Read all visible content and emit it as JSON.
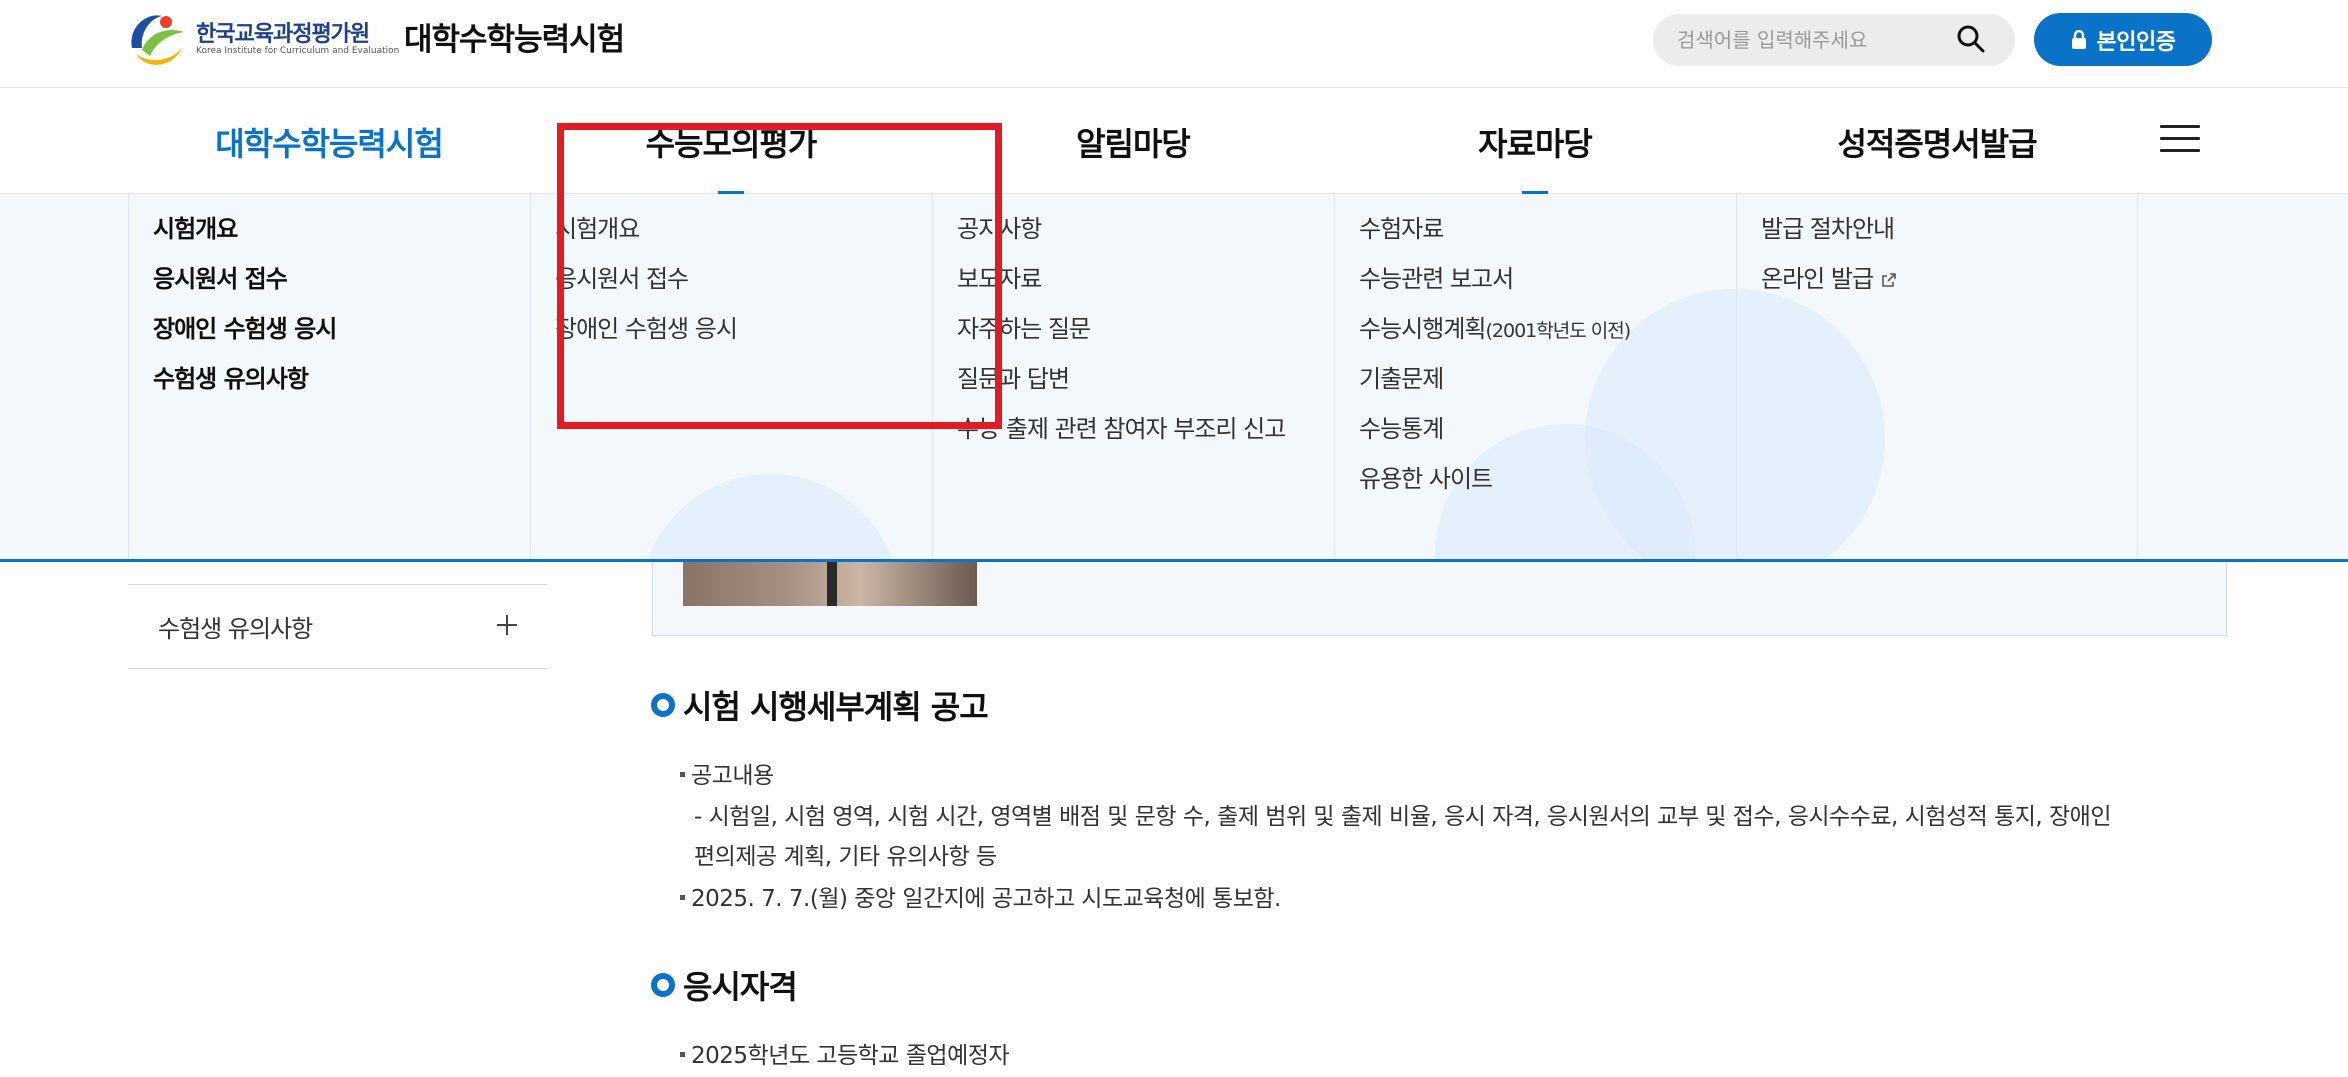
{
  "header": {
    "logo": {
      "name_ko": "한국교육과정평가원",
      "name_en": "Korea Institute for Curriculum and Evaluation"
    },
    "site_title": "대학수학능력시험",
    "search": {
      "placeholder": "검색어를 입력해주세요",
      "value": ""
    },
    "auth_button": "본인인증"
  },
  "gnb": {
    "items": [
      {
        "label": "대학수학능력시험",
        "active": true
      },
      {
        "label": "수능모의평가",
        "active": false
      },
      {
        "label": "알림마당",
        "active": false
      },
      {
        "label": "자료마당",
        "active": false
      },
      {
        "label": "성적증명서발급",
        "active": false
      }
    ]
  },
  "mega_menu": {
    "col1": [
      "시험개요",
      "응시원서 접수",
      "장애인 수험생 응시",
      "수험생 유의사항"
    ],
    "col2": [
      "시험개요",
      "응시원서 접수",
      "장애인 수험생 응시"
    ],
    "col3": [
      "공지사항",
      "보도자료",
      "자주하는 질문",
      "질문과 답변",
      "수능 출제 관련 참여자 부조리 신고"
    ],
    "col4": {
      "item1": "수험자료",
      "item2": "수능관련 보고서",
      "item3_main": "수능시행계획",
      "item3_note": "(2001학년도 이전)",
      "item4": "기출문제",
      "item5": "수능통계",
      "item6": "유용한 사이트"
    },
    "col5": [
      "발급 절차안내",
      "온라인 발급"
    ]
  },
  "sidebar": {
    "item_label": "수험생 유의사항"
  },
  "content": {
    "section1": {
      "title": "시험 시행세부계획 공고",
      "bullet1": "공고내용",
      "sub1_line1": "- 시험일, 시험 영역, 시험 시간, 영역별 배점 및 문항 수, 출제 범위 및 출제 비율, 응시 자격, 응시원서의 교부 및 접수, 응시수수료, 시험성적 통지, 장애인",
      "sub1_line2": "편의제공 계획, 기타 유의사항 등",
      "bullet2": "2025. 7. 7.(월) 중앙 일간지에 공고하고 시도교육청에 통보함."
    },
    "section2": {
      "title": "응시자격",
      "bullet1": "2025학년도 고등학교 졸업예정자"
    }
  },
  "colors": {
    "accent": "#0b73c7",
    "highlight": "#e31b23",
    "mega_bg": "#f3f8fd"
  }
}
